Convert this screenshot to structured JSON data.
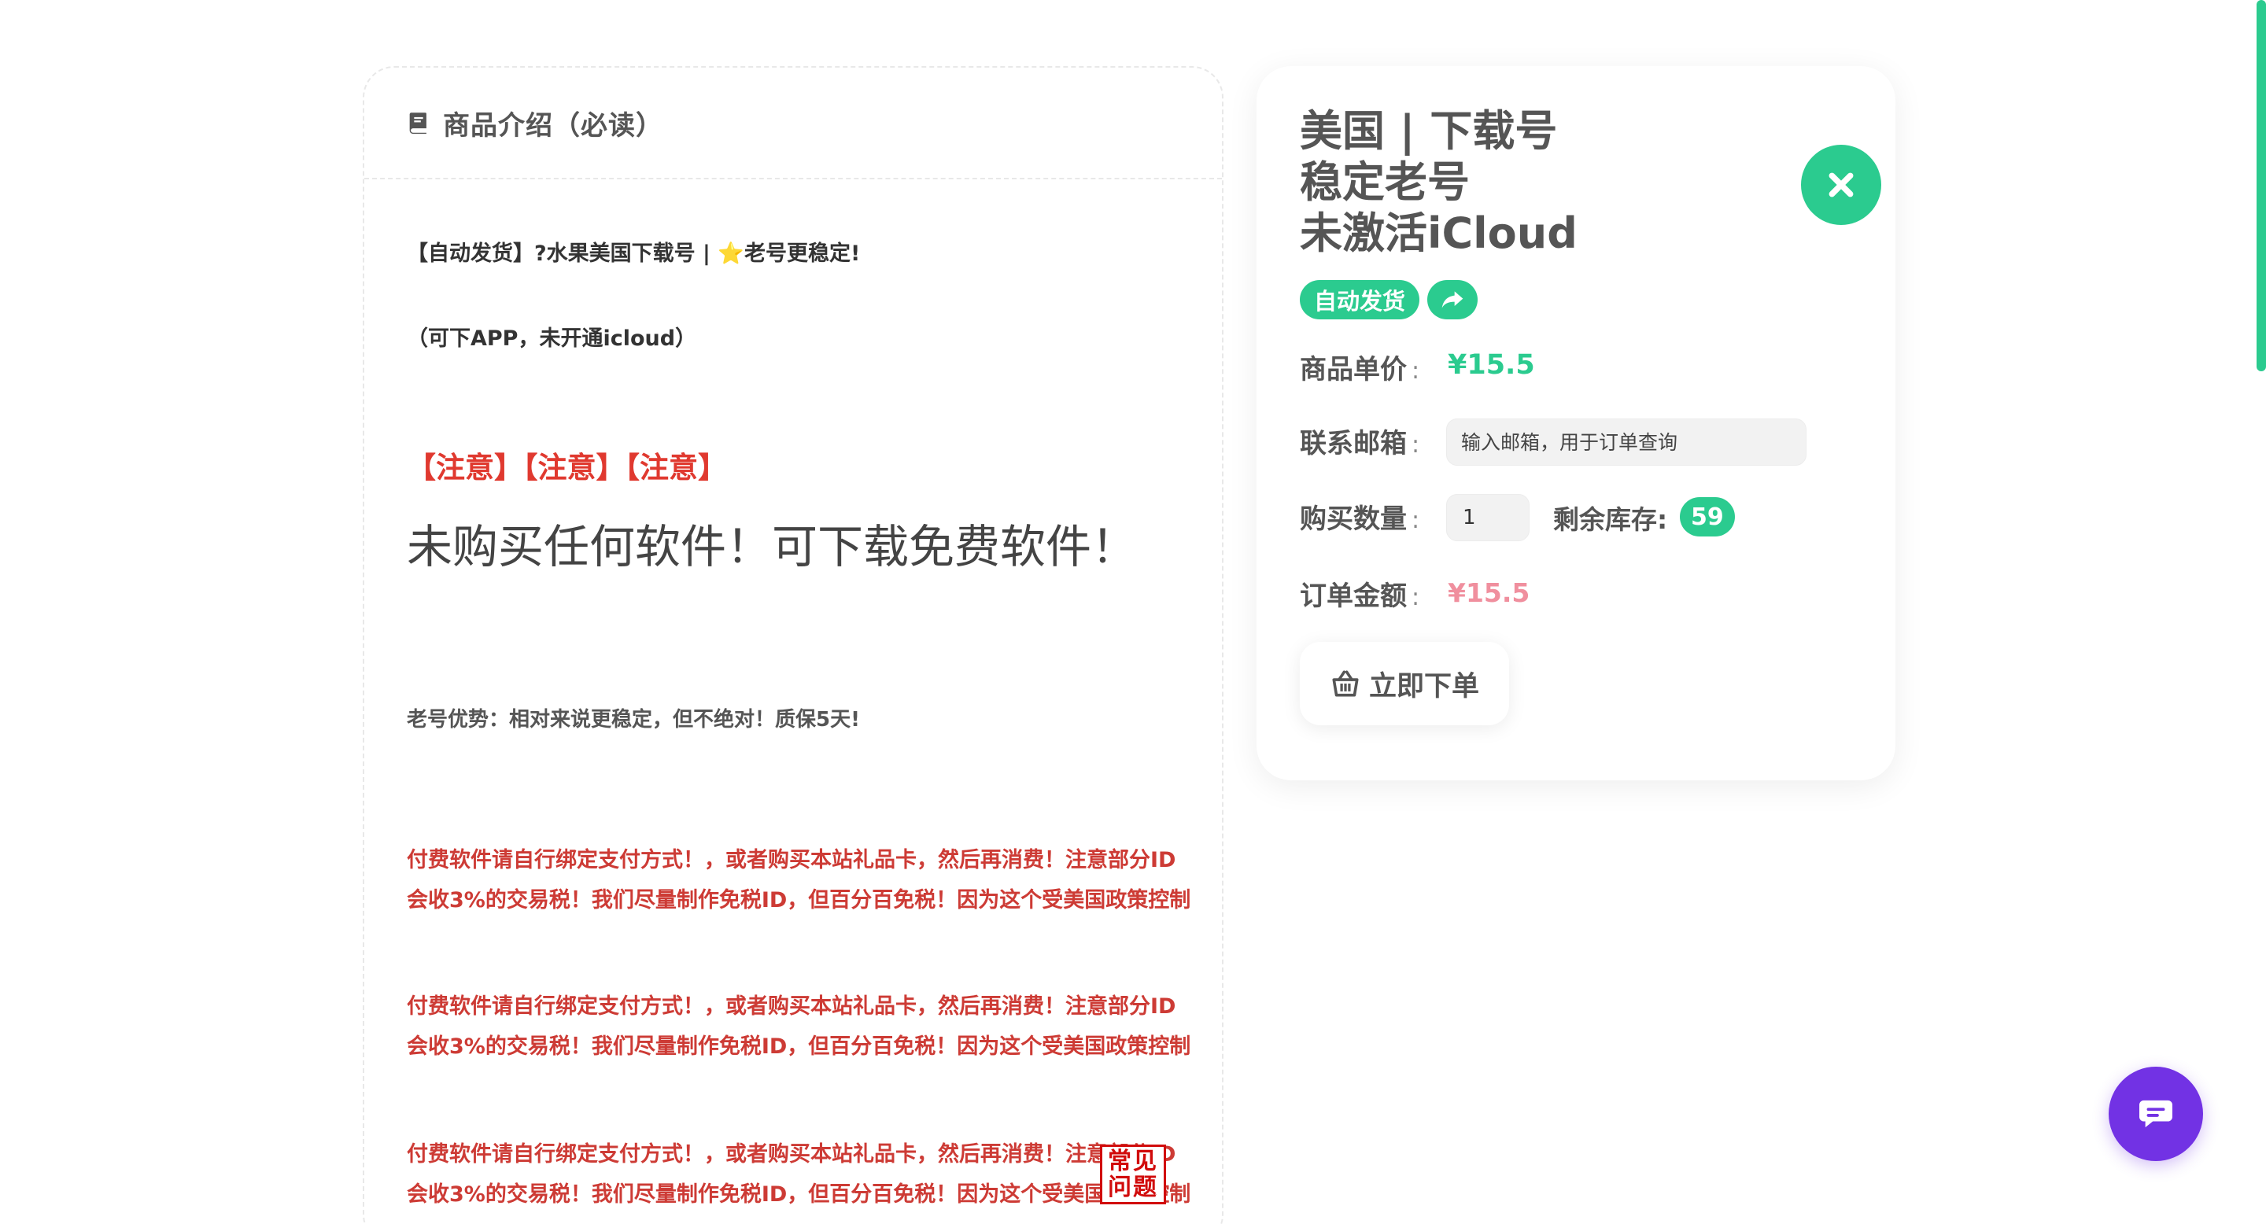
{
  "description": {
    "title": "商品介绍（必读）",
    "line1": "【自动发货】?水果美国下载号 | ⭐老号更稳定!",
    "line2": "（可下APP，未开通icloud）",
    "notice": "【注意】【注意】【注意】",
    "big_notice": "未购买任何软件！可下载免费软件！",
    "advantage": "老号优势：相对来说更稳定，但不绝对！质保5天!",
    "warnings": [
      "付费软件请自行绑定支付方式！，或者购买本站礼品卡，然后再消费！注意部分ID会收3%的交易税！我们尽量制作免税ID，但百分百免税！因为这个受美国政策控制",
      "付费软件请自行绑定支付方式！，或者购买本站礼品卡，然后再消费！注意部分ID会收3%的交易税！我们尽量制作免税ID，但百分百免税！因为这个受美国政策控制",
      "付费软件请自行绑定支付方式！，或者购买本站礼品卡，然后再消费！注意部分ID会收3%的交易税！我们尽量制作免税ID，但百分百免税！因为这个受美国政策控制"
    ],
    "faq_stamp": "常见问题"
  },
  "product": {
    "title_lines": [
      "美国 | 下载号",
      "稳定老号",
      "未激活iCloud"
    ],
    "tag_auto": "自动发货",
    "price_label": "商品单价",
    "price": "¥15.5",
    "email_label": "联系邮箱",
    "email_placeholder": "输入邮箱，用于订单查询",
    "qty_label": "购买数量",
    "qty_value": "1",
    "stock_label": "剩余库存:",
    "stock": "59",
    "total_label": "订单金额",
    "total": "¥15.5",
    "order_button": "立即下单",
    "colon": ":"
  },
  "colors": {
    "accent": "#2bcb8f",
    "warning_red": "#cd3b35",
    "notice_red": "#e0392f",
    "total_pink": "#f08f9e",
    "chat_purple": "#7232e4"
  },
  "icons": {
    "header": "book-icon",
    "close": "close-icon",
    "share": "share-icon",
    "order": "basket-icon",
    "chat": "chat-icon"
  }
}
